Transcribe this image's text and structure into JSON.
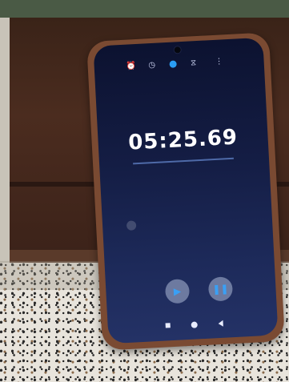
{
  "status_bar": {
    "time": "",
    "icons": ""
  },
  "tabs": [
    {
      "icon": "alarm-icon"
    },
    {
      "icon": "clock-icon"
    },
    {
      "icon": "stopwatch-icon",
      "active": true
    },
    {
      "icon": "timer-icon"
    },
    {
      "icon": "more-icon"
    }
  ],
  "stopwatch": {
    "time": "05:25.69"
  },
  "controls": {
    "start_icon": "▶",
    "pause_icon": "❚❚"
  },
  "colors": {
    "accent": "#2a9df4",
    "screen_bg": "#141d44",
    "case": "#7a4a32"
  }
}
